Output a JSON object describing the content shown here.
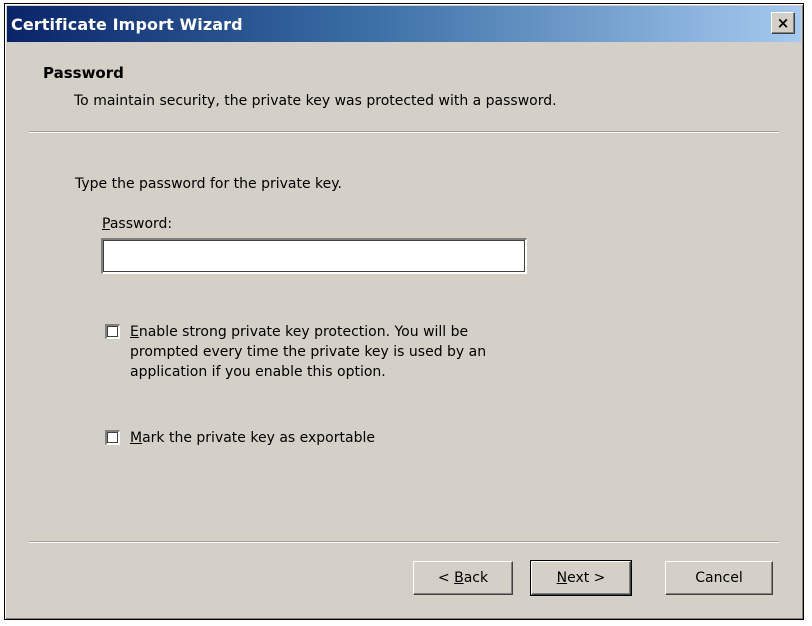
{
  "window": {
    "title": "Certificate Import Wizard",
    "close_glyph": "×"
  },
  "header": {
    "title": "Password",
    "subtitle": "To maintain security, the private key was protected with a password."
  },
  "body": {
    "instruction": "Type the password for the private key.",
    "password_label_accel": "P",
    "password_label_rest": "assword:",
    "password_value": "",
    "strong_protection": {
      "checked": false,
      "label_accel": "E",
      "label_rest": "nable strong private key protection. You will be\nprompted every time the private key is used by an\napplication if you enable this option."
    },
    "exportable": {
      "checked": false,
      "label_accel": "M",
      "label_rest": "ark the private key as exportable"
    }
  },
  "buttons": {
    "back_prefix": "< ",
    "back_accel": "B",
    "back_rest": "ack",
    "next_accel": "N",
    "next_rest": "ext >",
    "cancel_label": "Cancel"
  },
  "colors": {
    "dialog_bg": "#d4d0c8",
    "titlebar_start": "#0a246a",
    "titlebar_end": "#a6caf0"
  }
}
